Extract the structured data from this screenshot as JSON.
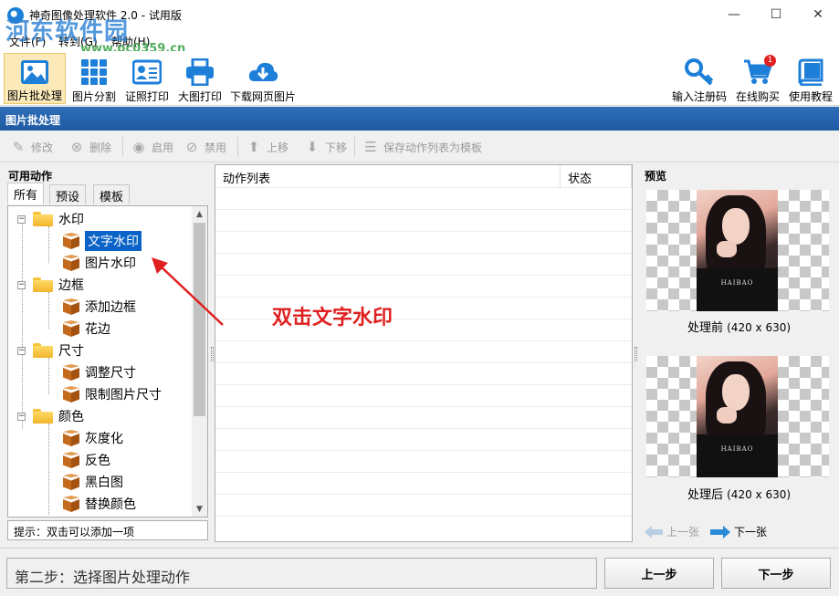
{
  "window": {
    "title": "神奇图像处理软件 2.0 - 试用版",
    "minimize": "—",
    "maximize": "☐",
    "close": "✕"
  },
  "watermark": {
    "logo": "河东软件园",
    "url": "www.pc0359.cn"
  },
  "menu": [
    {
      "label": "文件(F)"
    },
    {
      "label": "转到(G)"
    },
    {
      "label": "帮助(H)"
    }
  ],
  "toolbar": {
    "left": [
      {
        "label": "图片批处理",
        "icon": "image-icon",
        "active": true
      },
      {
        "label": "图片分割",
        "icon": "grid-icon"
      },
      {
        "label": "证照打印",
        "icon": "id-card-icon"
      },
      {
        "label": "大图打印",
        "icon": "printer-icon"
      },
      {
        "label": "下载网页图片",
        "icon": "cloud-download-icon"
      }
    ],
    "right": [
      {
        "label": "输入注册码",
        "icon": "key-icon"
      },
      {
        "label": "在线购买",
        "icon": "cart-icon",
        "badge": "1"
      },
      {
        "label": "使用教程",
        "icon": "book-icon"
      }
    ]
  },
  "section_title": "图片批处理",
  "actions": [
    {
      "label": "修改",
      "icon": "pencil-icon"
    },
    {
      "label": "删除",
      "icon": "delete-icon"
    },
    {
      "label": "启用",
      "icon": "eye-icon"
    },
    {
      "label": "禁用",
      "icon": "eye-off-icon"
    },
    {
      "label": "上移",
      "icon": "arrow-up-icon"
    },
    {
      "label": "下移",
      "icon": "arrow-down-icon"
    },
    {
      "label": "保存动作列表为模板",
      "icon": "list-icon"
    }
  ],
  "left_panel": {
    "title": "可用动作",
    "tabs": [
      "所有",
      "预设",
      "模板"
    ],
    "tree": [
      {
        "type": "folder",
        "label": "水印"
      },
      {
        "type": "item",
        "label": "文字水印",
        "selected": true
      },
      {
        "type": "item",
        "label": "图片水印"
      },
      {
        "type": "folder",
        "label": "边框"
      },
      {
        "type": "item",
        "label": "添加边框"
      },
      {
        "type": "item",
        "label": "花边"
      },
      {
        "type": "folder",
        "label": "尺寸"
      },
      {
        "type": "item",
        "label": "调整尺寸"
      },
      {
        "type": "item",
        "label": "限制图片尺寸"
      },
      {
        "type": "folder",
        "label": "颜色"
      },
      {
        "type": "item",
        "label": "灰度化"
      },
      {
        "type": "item",
        "label": "反色"
      },
      {
        "type": "item",
        "label": "黑白图"
      },
      {
        "type": "item",
        "label": "替换颜色"
      }
    ],
    "hint": "提示：双击可以添加一项"
  },
  "list": {
    "columns": [
      "动作列表",
      "状态"
    ],
    "annotation": "双击文字水印"
  },
  "preview": {
    "title": "预览",
    "before_label": "处理前",
    "after_label": "处理后",
    "size": "(420 x 630)",
    "photo_watermark": "HAIBAO",
    "prev": "上一张",
    "next": "下一张"
  },
  "footer": {
    "step_text": "第二步：选择图片处理动作",
    "prev_step": "上一步",
    "next_step": "下一步"
  }
}
